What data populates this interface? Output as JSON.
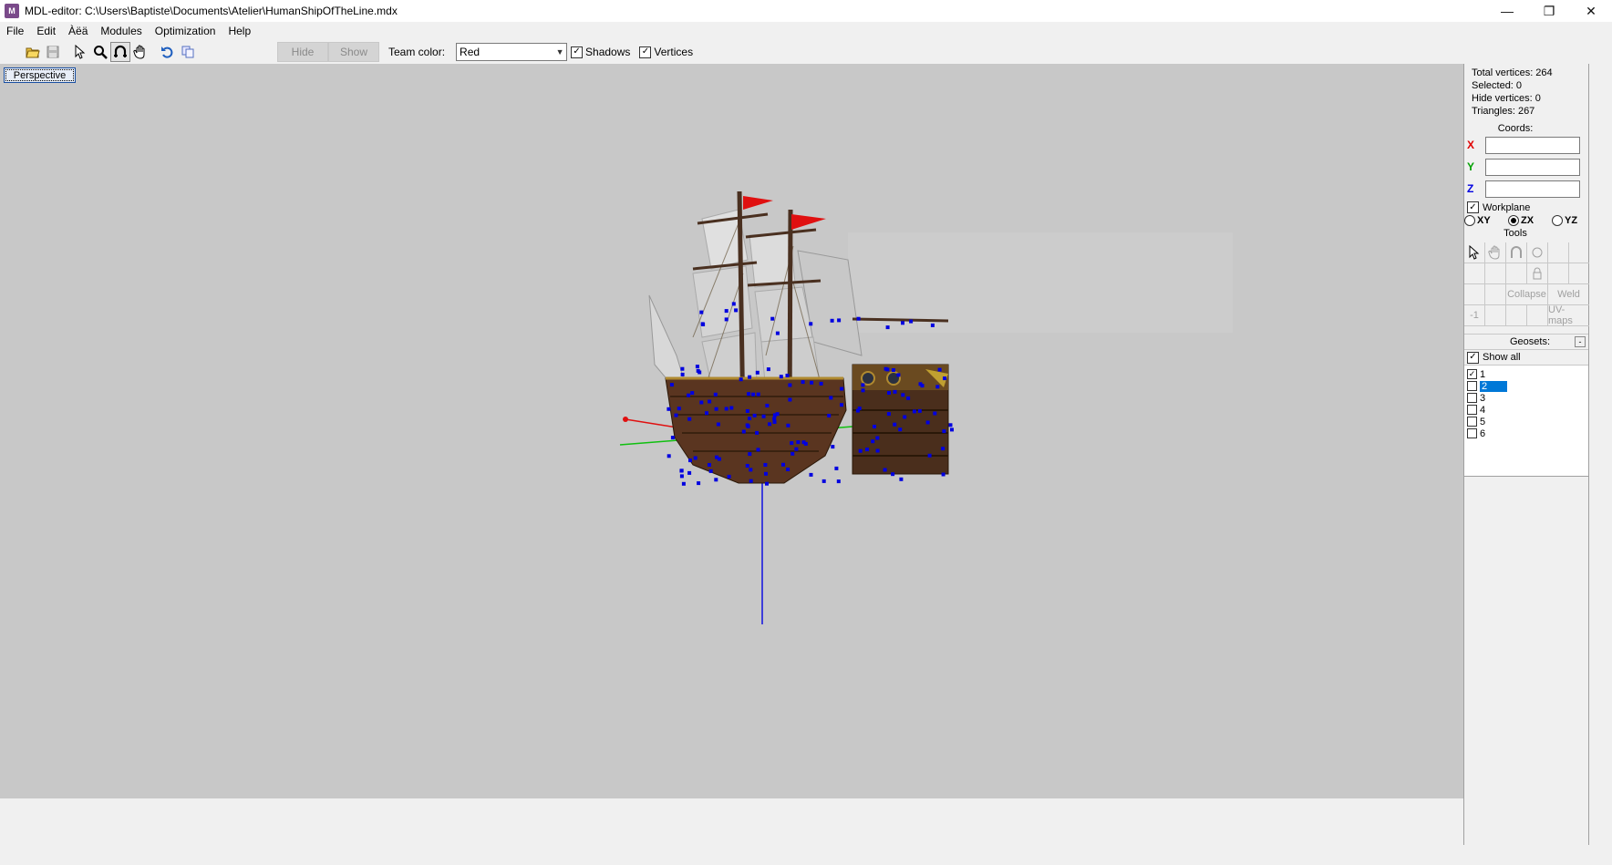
{
  "window": {
    "title": "MDL-editor: C:\\Users\\Baptiste\\Documents\\Atelier\\HumanShipOfTheLine.mdx",
    "controls": {
      "minimize": "—",
      "restore": "❐",
      "close": "✕"
    }
  },
  "menu": [
    {
      "label": "File"
    },
    {
      "label": "Edit"
    },
    {
      "label": "Àëä"
    },
    {
      "label": "Modules"
    },
    {
      "label": "Optimization"
    },
    {
      "label": "Help"
    }
  ],
  "toolbar": {
    "icons": [
      "open-icon",
      "save-icon",
      "select-cursor-icon",
      "zoom-icon",
      "rotate-icon",
      "pan-hand-icon",
      "undo-icon",
      "copy-icon"
    ],
    "hide_label": "Hide",
    "show_label": "Show",
    "team_color_label": "Team color:",
    "team_color_value": "Red",
    "shadows_label": "Shadows",
    "shadows_checked": true,
    "vertices_label": "Vertices",
    "vertices_checked": true
  },
  "viewport": {
    "mode_label": "Perspective",
    "background": "#c8c8c8",
    "vertex_color": "#0000e0",
    "axis_colors": {
      "x": "#e01010",
      "y": "#10c010",
      "z": "#1010e0"
    }
  },
  "panel": {
    "stats": {
      "total_vertices": "Total vertices: 264",
      "selected": "Selected: 0",
      "hide_vertices": "Hide vertices: 0",
      "triangles": "Triangles: 267"
    },
    "coords_title": "Coords:",
    "coords": [
      {
        "axis": "X",
        "color": "#e00000",
        "value": ""
      },
      {
        "axis": "Y",
        "color": "#00a000",
        "value": ""
      },
      {
        "axis": "Z",
        "color": "#0000e0",
        "value": ""
      }
    ],
    "workplane_label": "Workplane",
    "workplane_checked": true,
    "planes": [
      {
        "label": "XY",
        "selected": false
      },
      {
        "label": "ZX",
        "selected": true
      },
      {
        "label": "YZ",
        "selected": false
      }
    ],
    "tools_title": "Tools",
    "tools": {
      "collapse_label": "Collapse",
      "weld_label": "Weld",
      "minus_one_label": "-1",
      "uvmaps_label": "UV-maps"
    },
    "geosets_title": "Geosets:",
    "geosets_minimize": "-",
    "show_all_label": "Show all",
    "show_all_checked": true,
    "geosets": [
      {
        "label": "1",
        "checked": true,
        "selected": false
      },
      {
        "label": "2",
        "checked": false,
        "selected": true
      },
      {
        "label": "3",
        "checked": false,
        "selected": false
      },
      {
        "label": "4",
        "checked": false,
        "selected": false
      },
      {
        "label": "5",
        "checked": false,
        "selected": false
      },
      {
        "label": "6",
        "checked": false,
        "selected": false
      }
    ]
  }
}
